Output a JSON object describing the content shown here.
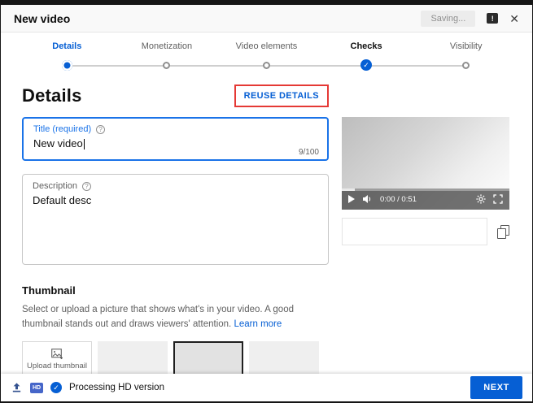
{
  "colors": {
    "accent": "#065fd4",
    "focus_border": "#1a73e8",
    "annotation_red": "#e53935"
  },
  "icons": {
    "check": "✓",
    "close": "✕",
    "help": "?",
    "feedback": "!"
  },
  "header": {
    "title": "New video",
    "saving": "Saving..."
  },
  "stepper": {
    "steps": [
      {
        "label": "Details",
        "state": "active"
      },
      {
        "label": "Monetization",
        "state": "inactive"
      },
      {
        "label": "Video elements",
        "state": "inactive"
      },
      {
        "label": "Checks",
        "state": "complete"
      },
      {
        "label": "Visibility",
        "state": "inactive"
      }
    ]
  },
  "details": {
    "heading": "Details",
    "reuse_button": "REUSE DETAILS",
    "title_field": {
      "label": "Title (required)",
      "value": "New video",
      "counter": "9/100"
    },
    "description_field": {
      "label": "Description",
      "value": "Default desc"
    }
  },
  "player": {
    "time": "0:00 / 0:51"
  },
  "thumbnail": {
    "heading": "Thumbnail",
    "text": "Select or upload a picture that shows what's in your video. A good thumbnail stands out and draws viewers' attention.",
    "learn_more": "Learn more",
    "upload_label": "Upload thumbnail"
  },
  "footer": {
    "hd_badge": "HD",
    "status": "Processing HD version",
    "next_button": "NEXT"
  }
}
